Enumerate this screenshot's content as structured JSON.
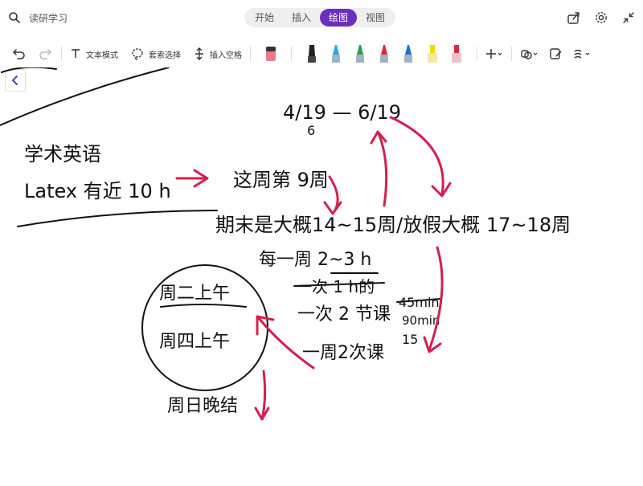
{
  "header": {
    "search_label": "读研学习",
    "tabs": [
      {
        "label": "开始"
      },
      {
        "label": "插入"
      },
      {
        "label": "绘图"
      },
      {
        "label": "视图"
      }
    ]
  },
  "toolbar": {
    "text_mode": "文本模式",
    "lasso": "套索选择",
    "insert_space": "插入空格"
  },
  "colors": {
    "accent": "#6b2fbf",
    "ink_red": "#d3204e",
    "pens": [
      "#222222",
      "#2aa8e0",
      "#24a148",
      "#e3263b",
      "#1f6fd8",
      "#f5d90a",
      "#e0263b"
    ]
  },
  "notes": {
    "date_range": "4/19 — 6/19",
    "date_sub": "6",
    "academic_english": "学术英语",
    "latex": "Latex 有近 10 h",
    "now_week": "这周第 9周",
    "finals": "期末是大概14~15周/放假大概 17~18周",
    "per_week": "每一周 2~3 h",
    "once_crossed": "一次 1 h的",
    "once_two": "一次 2 节课",
    "min_crossed": "45min",
    "min_90": "90min",
    "fifteen": "15",
    "twice_week": "一周2次课",
    "tue_morning": "周二上午",
    "thu_morning": "周四上午",
    "weekend": "周日晚结"
  }
}
